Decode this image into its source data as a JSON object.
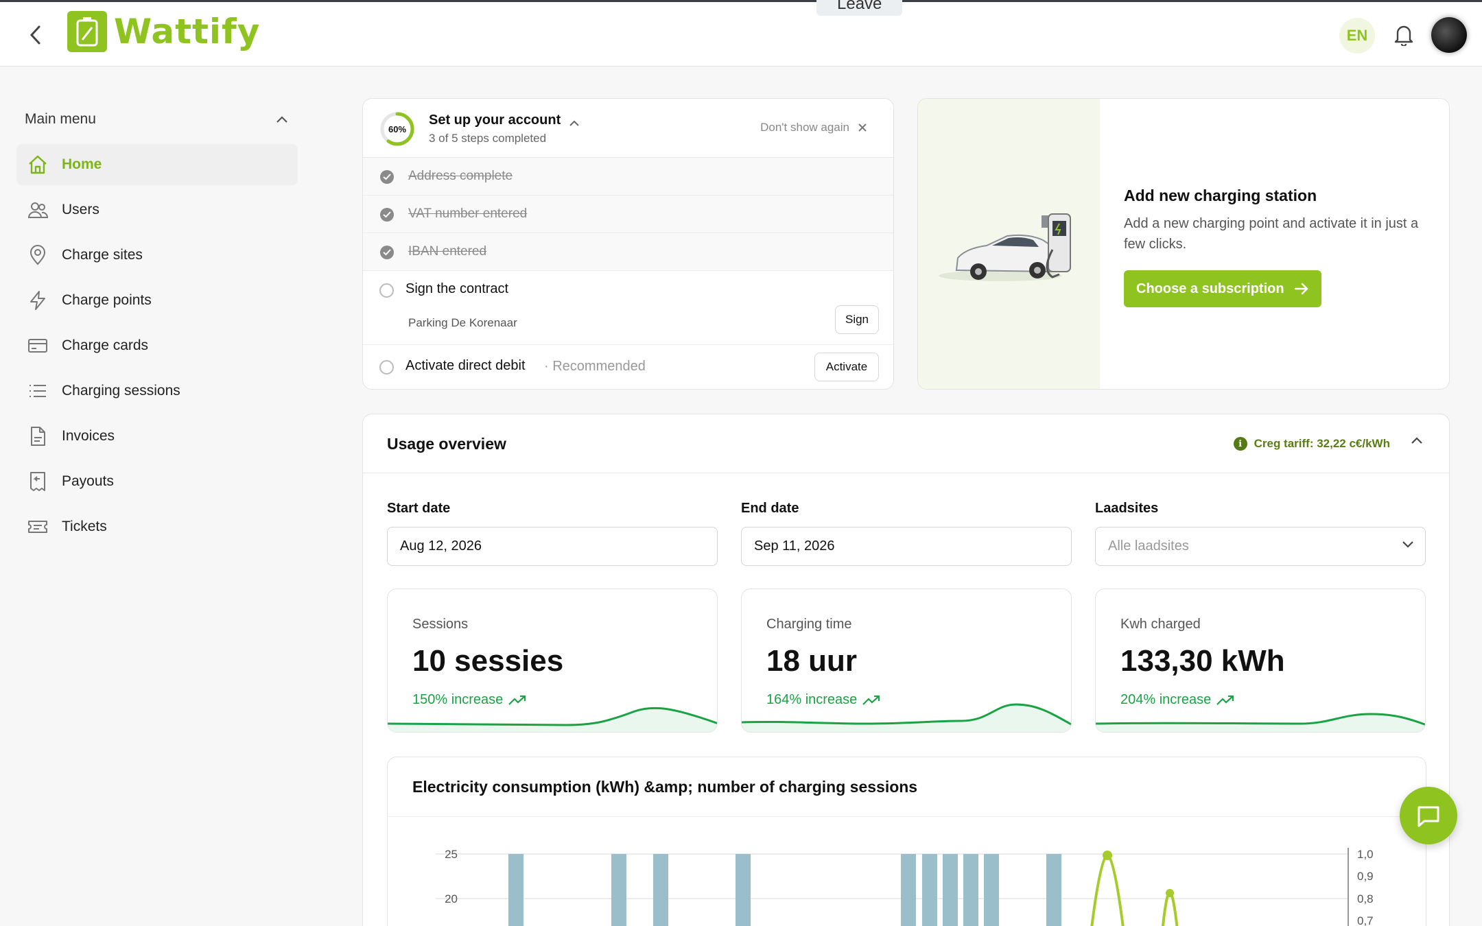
{
  "header": {
    "logo_text": "Wattify",
    "leave_label": "Leave",
    "language": "EN"
  },
  "sidebar": {
    "menu_title": "Main menu",
    "items": [
      {
        "label": "Home",
        "icon": "home-icon"
      },
      {
        "label": "Users",
        "icon": "users-icon"
      },
      {
        "label": "Charge sites",
        "icon": "map-pin-icon"
      },
      {
        "label": "Charge points",
        "icon": "lightning-icon"
      },
      {
        "label": "Charge cards",
        "icon": "card-icon"
      },
      {
        "label": "Charging sessions",
        "icon": "list-icon"
      },
      {
        "label": "Invoices",
        "icon": "document-icon"
      },
      {
        "label": "Payouts",
        "icon": "receipt-icon"
      },
      {
        "label": "Tickets",
        "icon": "ticket-icon"
      }
    ]
  },
  "setup": {
    "progress_label": "60%",
    "progress_fraction": 0.6,
    "title": "Set up your account",
    "subtitle": "3 of 5 steps completed",
    "dont_show": "Don't show again",
    "completed_steps": [
      "Address complete",
      "VAT number entered",
      "IBAN entered"
    ],
    "contract_step": "Sign the contract",
    "contract_site": "Parking De Korenaar",
    "sign_label": "Sign",
    "debit_step": "Activate direct debit",
    "debit_note": "· Recommended",
    "activate_label": "Activate"
  },
  "add_station": {
    "title": "Add new charging station",
    "description": "Add a new charging point and activate it in just a few clicks.",
    "button": "Choose a subscription"
  },
  "usage": {
    "title": "Usage overview",
    "tariff": "Creg tariff: 32,22 c€/kWh",
    "start_label": "Start date",
    "start_value": "Aug 12, 2026",
    "end_label": "End date",
    "end_value": "Sep 11, 2026",
    "sites_label": "Laadsites",
    "sites_placeholder": "Alle laadsites",
    "stats": [
      {
        "label": "Sessions",
        "value": "10 sessies",
        "change": "150% increase"
      },
      {
        "label": "Charging time",
        "value": "18 uur",
        "change": "164% increase"
      },
      {
        "label": "Kwh charged",
        "value": "133,30 kWh",
        "change": "204% increase"
      }
    ]
  },
  "chart_data": {
    "type": "bar",
    "title": "Electricity consumption (kWh) &amp; number of charging sessions",
    "left_ticks": [
      "25",
      "20"
    ],
    "right_ticks": [
      "1,0",
      "0,9",
      "0,8",
      "0,7"
    ],
    "bar_count": 10,
    "colors": {
      "bars": "#9bbfca",
      "line": "#a6cc2b"
    }
  }
}
